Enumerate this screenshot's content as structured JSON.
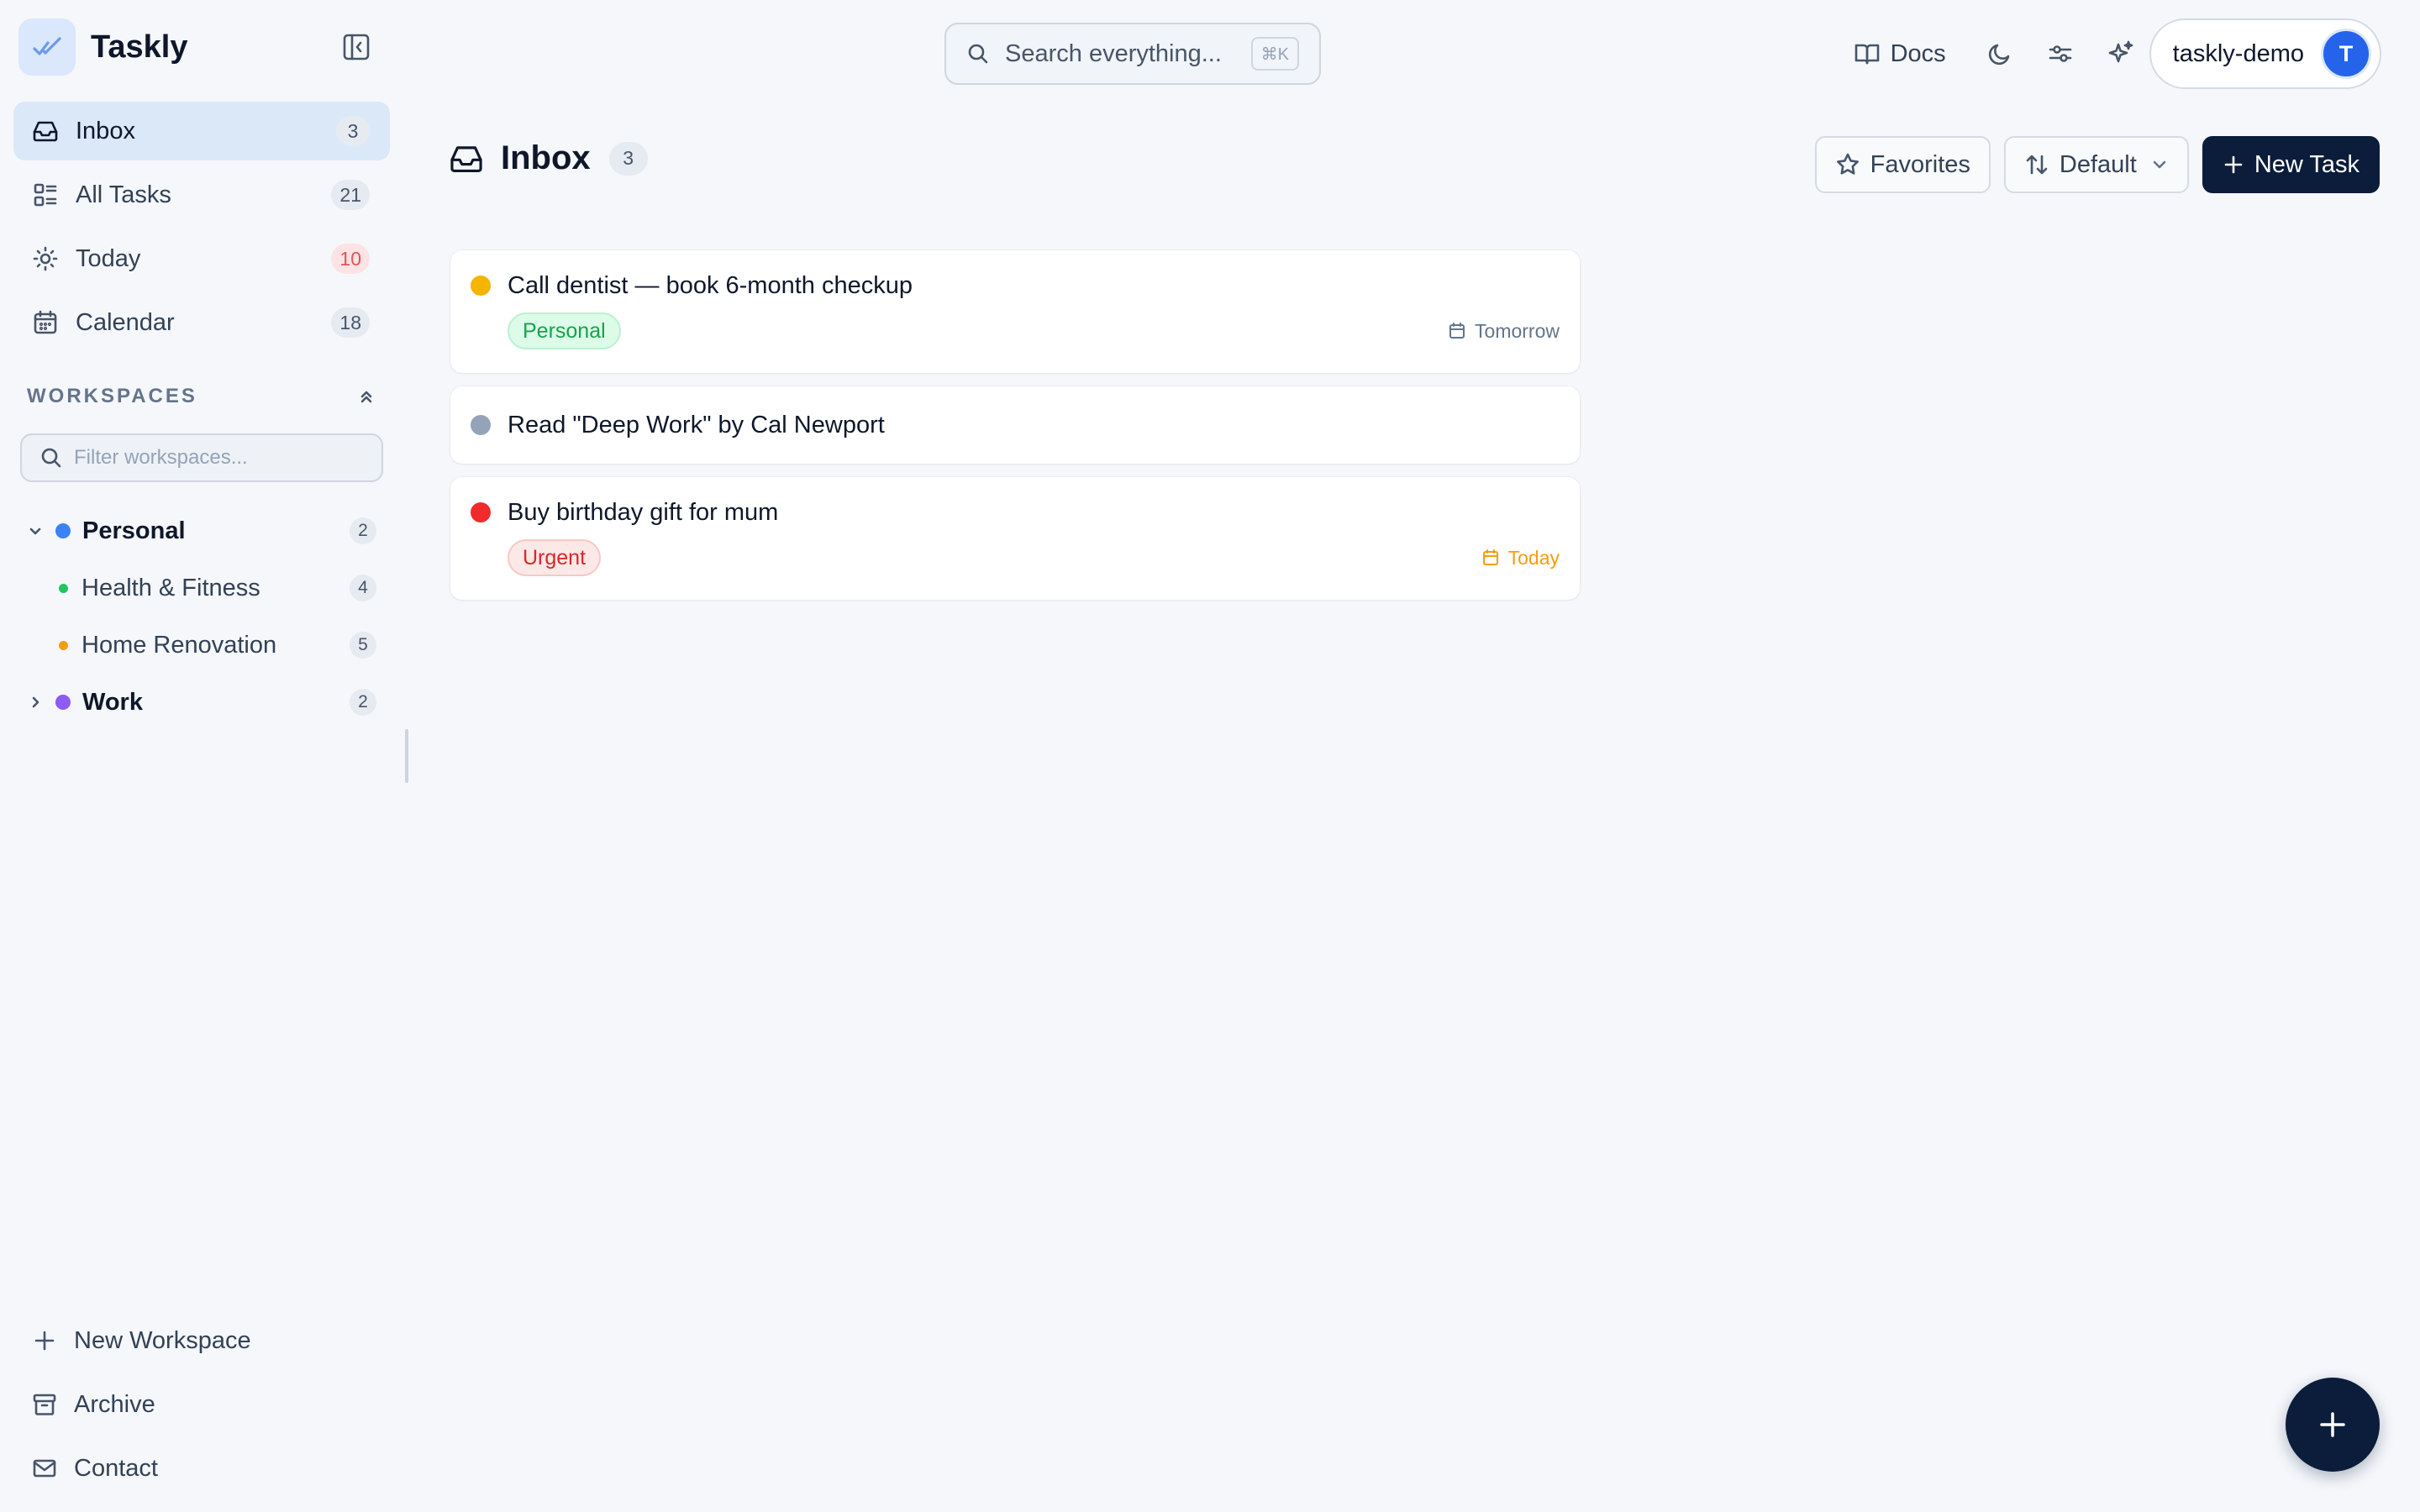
{
  "app": {
    "name": "Taskly"
  },
  "nav": [
    {
      "label": "Inbox",
      "count": "3",
      "icon": "inbox-icon",
      "active": true
    },
    {
      "label": "All Tasks",
      "count": "21",
      "icon": "list-icon"
    },
    {
      "label": "Today",
      "count": "10",
      "icon": "sun-icon"
    },
    {
      "label": "Calendar",
      "count": "18",
      "icon": "calendar-icon"
    }
  ],
  "workspaces": {
    "title": "WORKSPACES",
    "filter_placeholder": "Filter workspaces...",
    "items": [
      {
        "label": "Personal",
        "count": "2",
        "color": "#3b82f6",
        "expanded": true
      },
      {
        "label": "Health & Fitness",
        "count": "4",
        "color": "#22c55e"
      },
      {
        "label": "Home Renovation",
        "count": "5",
        "color": "#f59e0b"
      },
      {
        "label": "Work",
        "count": "2",
        "color": "#8b5cf6",
        "expanded": false
      }
    ]
  },
  "bottom_nav": [
    {
      "label": "New Workspace",
      "icon": "plus-icon"
    },
    {
      "label": "Archive",
      "icon": "archive-icon"
    },
    {
      "label": "Contact",
      "icon": "mail-icon"
    }
  ],
  "topbar": {
    "search_placeholder": "Search everything...",
    "shortcut": "⌘K",
    "docs_label": "Docs",
    "user_name": "taskly-demo",
    "user_initial": "T"
  },
  "page": {
    "title": "Inbox",
    "count": "3",
    "favorites_label": "Favorites",
    "sort_label": "Default",
    "new_task_label": "New Task"
  },
  "tasks": [
    {
      "title": "Call dentist — book 6-month checkup",
      "priority_color": "#f5b400",
      "tag": "Personal",
      "tag_color": "#16a34a",
      "due": "Tomorrow",
      "due_color": "#64748b"
    },
    {
      "title": "Read \"Deep Work\" by Cal Newport",
      "priority_color": "#94a3b8"
    },
    {
      "title": "Buy birthday gift for mum",
      "priority_color": "#ef2b2b",
      "tag": "Urgent",
      "tag_color": "#dc2626",
      "due": "Today",
      "due_color": "#f59e0b"
    }
  ],
  "colors": {
    "accent": "#0b1d3a",
    "active_nav": "#dbe8f8",
    "avatar": "#2563eb"
  }
}
